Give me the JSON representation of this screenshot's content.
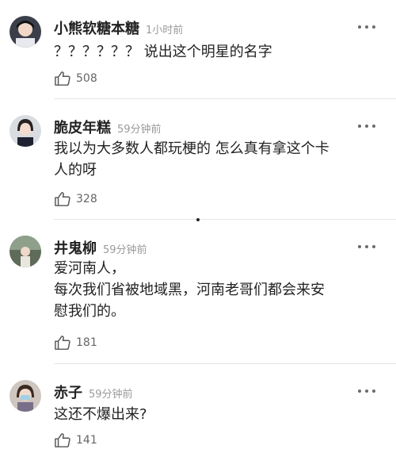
{
  "comments": [
    {
      "name": "小熊软糖本糖",
      "time": "1小时前",
      "text": "？？？？？？ 说出这个明星的名字",
      "likes": "508"
    },
    {
      "name": "脆皮年糕",
      "time": "59分钟前",
      "text": "我以为大多数人都玩梗的 怎么真有拿这个卡\n人的呀",
      "likes": "328"
    },
    {
      "name": "井鬼柳",
      "time": "59分钟前",
      "text": "爱河南人，\n每次我们省被地域黑，河南老哥们都会来安\n慰我们的。",
      "likes": "181"
    },
    {
      "name": "赤子",
      "time": "59分钟前",
      "text": "这还不爆出来?",
      "likes": "141"
    }
  ],
  "icons": {
    "more": "more-dots-icon",
    "like": "thumbs-up-icon"
  },
  "colors": {
    "name": "#222222",
    "time": "#9a9a9a",
    "divider": "#e6e6e6"
  }
}
